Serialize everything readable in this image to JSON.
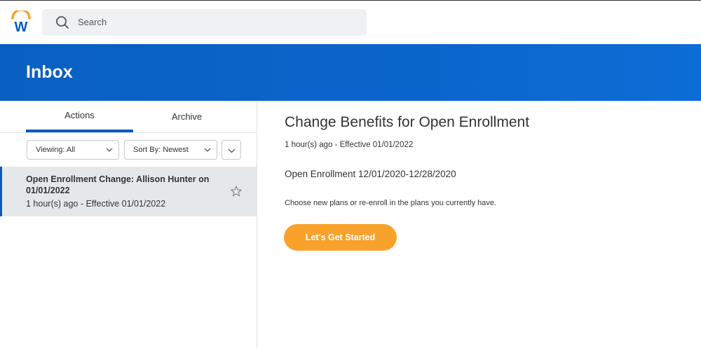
{
  "topbar": {
    "logo_icon": "workday-logo-icon",
    "search_icon": "search-icon",
    "search_placeholder": "Search"
  },
  "header": {
    "title": "Inbox"
  },
  "tabs": [
    {
      "label": "Actions",
      "active": true
    },
    {
      "label": "Archive",
      "active": false
    }
  ],
  "filters": {
    "viewing_label": "Viewing:",
    "viewing_value": "All",
    "sort_label": "Sort By:",
    "sort_value": "Newest"
  },
  "inbox_items": [
    {
      "title": "Open Enrollment Change: Allison Hunter on 01/01/2022",
      "subtitle": "1 hour(s) ago - Effective 01/01/2022",
      "starred": false
    }
  ],
  "detail": {
    "title": "Change Benefits for Open Enrollment",
    "subtitle": "1 hour(s) ago -  Effective 01/01/2022",
    "period": "Open Enrollment 12/01/2020-12/28/2020",
    "description": "Choose new plans or re-enroll in the plans you currently have.",
    "button_label": "Let's Get Started"
  },
  "colors": {
    "header_blue": "#0b66cc",
    "accent_blue": "#0b5bbf",
    "button_orange": "#f9a22b",
    "logo_orange": "#f9a22b",
    "logo_blue": "#0b5bbf"
  }
}
